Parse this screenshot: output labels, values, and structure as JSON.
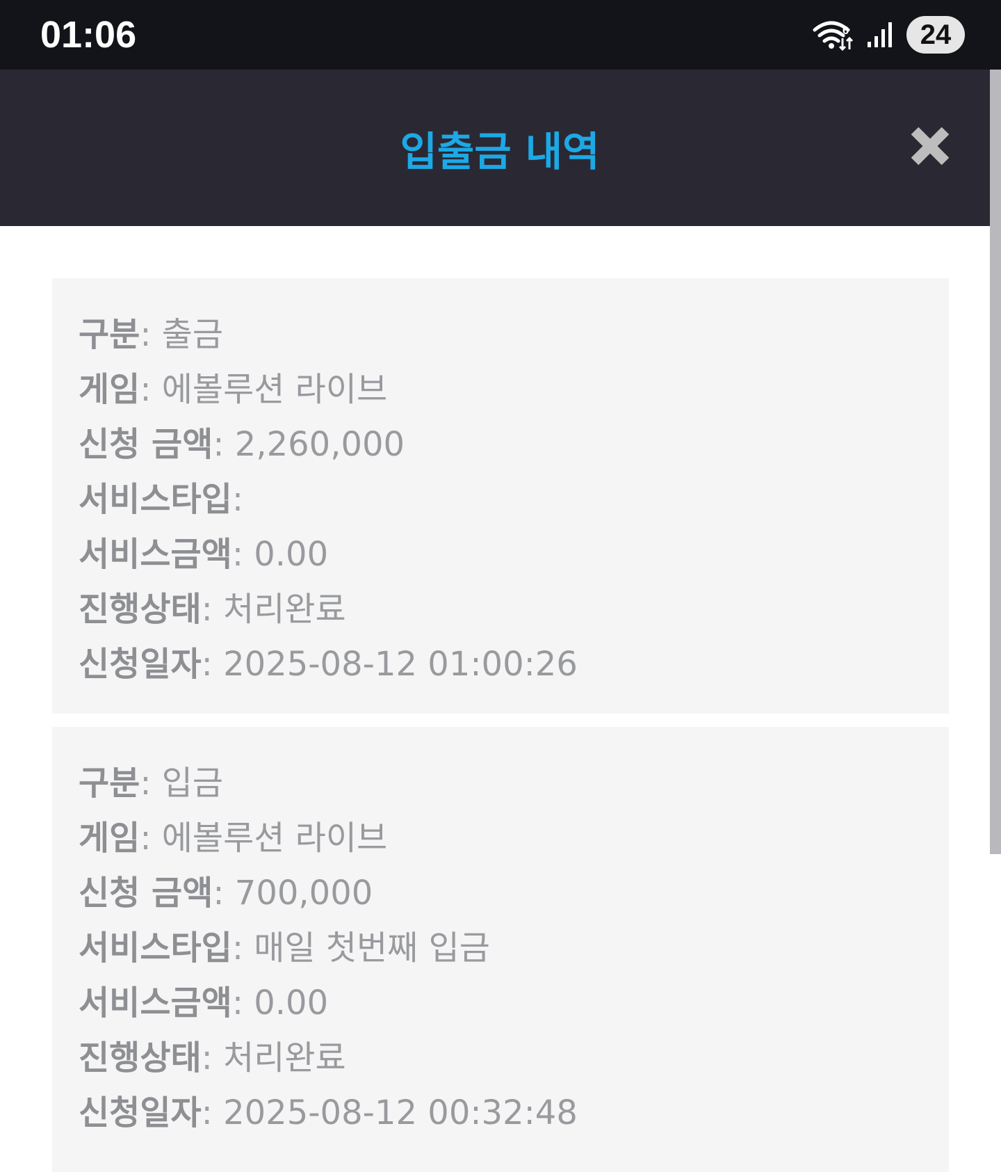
{
  "status_bar": {
    "time": "01:06",
    "battery": "24",
    "icons": [
      "wifi-icon",
      "signal-icon",
      "battery-icon"
    ]
  },
  "modal": {
    "title": "입출금 내역",
    "close_icon": "close-icon"
  },
  "labels": {
    "type": "구분",
    "game": "게임",
    "amount": "신청 금액",
    "service_type": "서비스타입",
    "service_amount": "서비스금액",
    "status": "진행상태",
    "date": "신청일자"
  },
  "records": [
    {
      "type": "출금",
      "game": "에볼루션 라이브",
      "amount": "2,260,000",
      "service_type": "",
      "service_amount": "0.00",
      "status": "처리완료",
      "date": "2025-08-12 01:00:26"
    },
    {
      "type": "입금",
      "game": "에볼루션 라이브",
      "amount": "700,000",
      "service_type": "매일 첫번째 입금",
      "service_amount": "0.00",
      "status": "처리완료",
      "date": "2025-08-12 00:32:48"
    }
  ],
  "colors": {
    "status_bar": "#131419",
    "header": "#2a2933",
    "title": "#1da8e6",
    "card": "#f5f5f6",
    "text": "#999a9e"
  }
}
